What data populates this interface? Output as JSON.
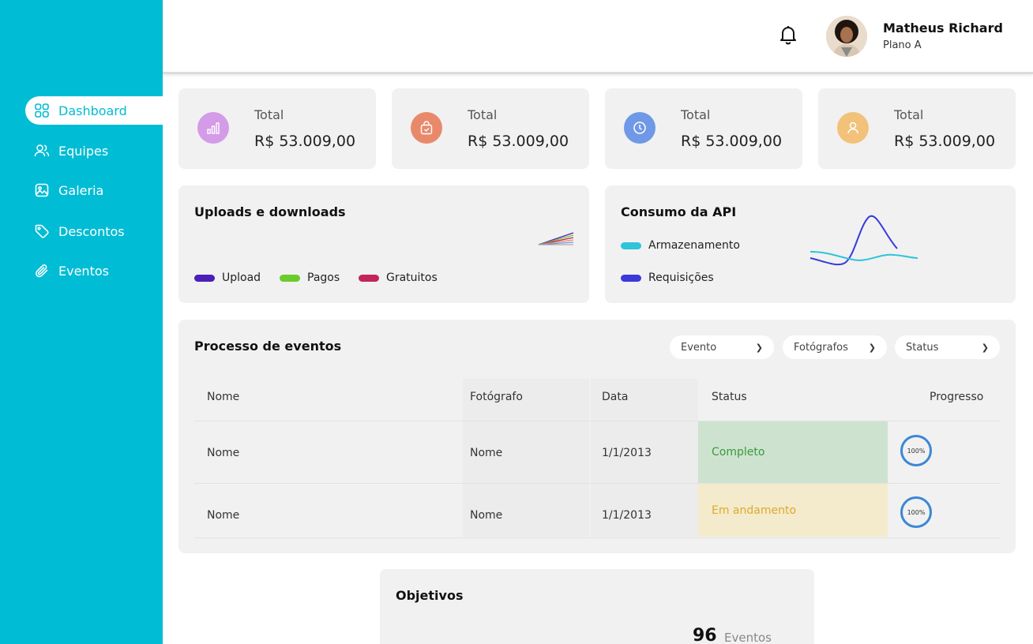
{
  "colors": {
    "sidebar": "#00BCD4",
    "card_bg": "#f1f1f1",
    "upload": "#4B1FB8",
    "pagos": "#6BCB2B",
    "gratuitos": "#C2255C",
    "armazenamento": "#2EC4D9",
    "requisicoes": "#3A3ADB",
    "complete_bg": "#cde3cf",
    "complete_text": "#3a9a3a",
    "progress_bg": "#f3ebcc",
    "progress_text": "#e0a92a"
  },
  "sidebar": {
    "items": [
      {
        "label": "Dashboard",
        "icon": "grid-icon",
        "active": true
      },
      {
        "label": "Equipes",
        "icon": "users-icon",
        "active": false
      },
      {
        "label": "Galeria",
        "icon": "image-icon",
        "active": false
      },
      {
        "label": "Descontos",
        "icon": "tag-icon",
        "active": false
      },
      {
        "label": "Eventos",
        "icon": "paperclip-icon",
        "active": false
      }
    ]
  },
  "header": {
    "user_name": "Matheus Richard",
    "plan": "Plano A",
    "notification_icon": "bell-icon"
  },
  "stats": [
    {
      "label": "Total",
      "value": "R$ 53.009,00",
      "icon": "bar-chart-icon",
      "color": "#D49BE8"
    },
    {
      "label": "Total",
      "value": "R$ 53.009,00",
      "icon": "bag-icon",
      "color": "#E9896B"
    },
    {
      "label": "Total",
      "value": "R$ 53.009,00",
      "icon": "clock-icon",
      "color": "#6F98E6"
    },
    {
      "label": "Total",
      "value": "R$ 53.009,00",
      "icon": "user-icon",
      "color": "#F2C27A"
    }
  ],
  "uploads": {
    "title": "Uploads e downloads",
    "legend": [
      "Upload",
      "Pagos",
      "Gratuitos"
    ]
  },
  "api": {
    "title": "Consumo da API",
    "legend": [
      "Armazenamento",
      "Requisições"
    ]
  },
  "events": {
    "title": "Processo de eventos",
    "filters": [
      "Evento",
      "Fotógrafos",
      "Status"
    ],
    "columns": [
      "Nome",
      "Fotógrafo",
      "Data",
      "Status",
      "Progresso"
    ],
    "rows": [
      {
        "nome": "Nome",
        "fotografo": "Nome",
        "data": "1/1/2013",
        "status": "Completo",
        "progresso": "100%"
      },
      {
        "nome": "Nome",
        "fotografo": "Nome",
        "data": "1/1/2013",
        "status": "Em andamento",
        "progresso": "100%"
      }
    ]
  },
  "goals": {
    "title": "Objetivos",
    "count": "96",
    "unit": "Eventos"
  }
}
